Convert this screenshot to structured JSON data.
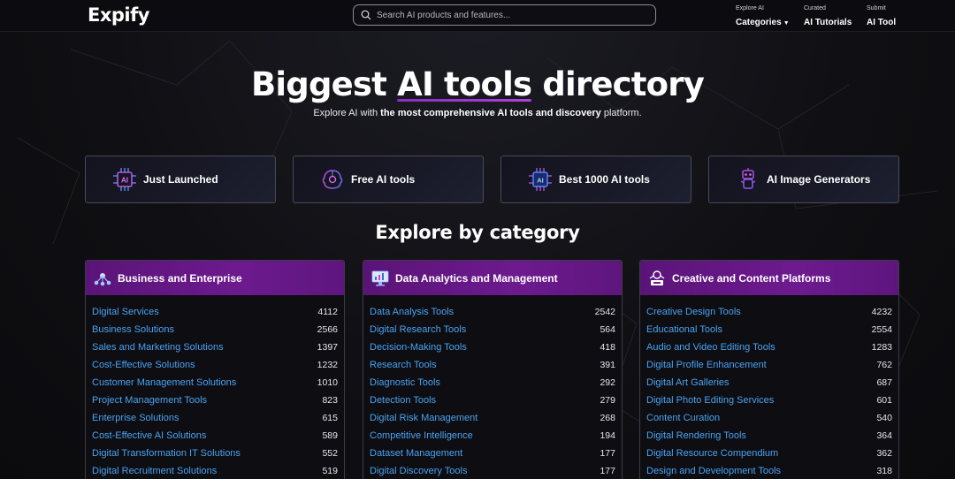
{
  "header": {
    "logo": "Expify",
    "search_placeholder": "Search AI products and features...",
    "nav": [
      {
        "small": "Explore AI",
        "big": "Categories"
      },
      {
        "small": "Curated",
        "big": "AI Tutorials"
      },
      {
        "small": "Submit",
        "big": "AI Tool"
      }
    ]
  },
  "hero": {
    "title_pre": "Biggest ",
    "title_accent": "AI tools",
    "title_post": " directory",
    "sub_pre": "Explore AI with ",
    "sub_bold": "the most comprehensive AI tools and discovery",
    "sub_post": " platform."
  },
  "quick_links": [
    {
      "label": "Just Launched",
      "icon": "ai-chip-icon"
    },
    {
      "label": "Free AI tools",
      "icon": "brain-gear-icon"
    },
    {
      "label": "Best 1000 AI tools",
      "icon": "ai-processor-icon"
    },
    {
      "label": "AI Image Generators",
      "icon": "robot-icon"
    }
  ],
  "section_title": "Explore by category",
  "categories": [
    {
      "title": "Business and Enterprise",
      "icon": "network-icon",
      "items": [
        {
          "label": "Digital Services",
          "count": "4112"
        },
        {
          "label": "Business Solutions",
          "count": "2566"
        },
        {
          "label": "Sales and Marketing Solutions",
          "count": "1397"
        },
        {
          "label": "Cost-Effective Solutions",
          "count": "1232"
        },
        {
          "label": "Customer Management Solutions",
          "count": "1010"
        },
        {
          "label": "Project Management Tools",
          "count": "823"
        },
        {
          "label": "Enterprise Solutions",
          "count": "615"
        },
        {
          "label": "Cost-Effective AI Solutions",
          "count": "589"
        },
        {
          "label": "Digital Transformation IT Solutions",
          "count": "552"
        },
        {
          "label": "Digital Recruitment Solutions",
          "count": "519"
        }
      ]
    },
    {
      "title": "Data Analytics and Management",
      "icon": "analytics-monitor-icon",
      "items": [
        {
          "label": "Data Analysis Tools",
          "count": "2542"
        },
        {
          "label": "Digital Research Tools",
          "count": "564"
        },
        {
          "label": "Decision-Making Tools",
          "count": "418"
        },
        {
          "label": "Research Tools",
          "count": "391"
        },
        {
          "label": "Diagnostic Tools",
          "count": "292"
        },
        {
          "label": "Detection Tools",
          "count": "279"
        },
        {
          "label": "Digital Risk Management",
          "count": "268"
        },
        {
          "label": "Competitive Intelligence",
          "count": "194"
        },
        {
          "label": "Dataset Management",
          "count": "177"
        },
        {
          "label": "Digital Discovery Tools",
          "count": "177"
        }
      ]
    },
    {
      "title": "Creative and Content Platforms",
      "icon": "creative-tools-icon",
      "items": [
        {
          "label": "Creative Design Tools",
          "count": "4232"
        },
        {
          "label": "Educational Tools",
          "count": "2554"
        },
        {
          "label": "Audio and Video Editing Tools",
          "count": "1283"
        },
        {
          "label": "Digital Profile Enhancement",
          "count": "762"
        },
        {
          "label": "Digital Art Galleries",
          "count": "687"
        },
        {
          "label": "Digital Photo Editing Services",
          "count": "601"
        },
        {
          "label": "Content Curation",
          "count": "540"
        },
        {
          "label": "Digital Rendering Tools",
          "count": "364"
        },
        {
          "label": "Digital Resource Compendium",
          "count": "362"
        },
        {
          "label": "Design and Development Tools",
          "count": "318"
        }
      ]
    }
  ]
}
